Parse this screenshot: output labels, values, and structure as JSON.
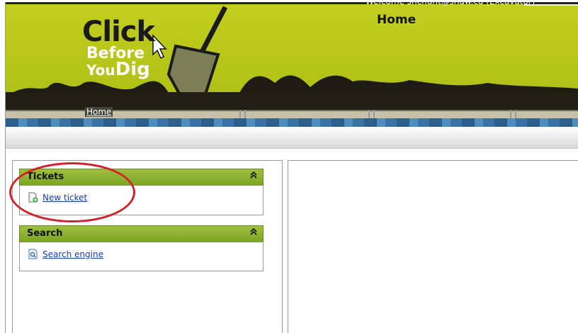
{
  "header": {
    "welcome_text": "Welcome shchunt@shaw.ca (Excavator)",
    "page_title": "Home",
    "logo_line1": "Click",
    "logo_line2": "Before",
    "logo_line3a": "You",
    "logo_line3b": "Dig"
  },
  "nav": {
    "home_label": "Home"
  },
  "panels": {
    "tickets": {
      "title": "Tickets",
      "collapse_glyph": "≈",
      "link_label": "New ticket"
    },
    "search": {
      "title": "Search",
      "collapse_glyph": "≈",
      "link_label": "Search engine"
    }
  },
  "colors": {
    "banner_green": "#b5c51a",
    "panel_header_green": "#8bb133",
    "link_blue": "#1a3aa8",
    "highlight_red": "#d3212a"
  },
  "icons": {
    "new_ticket": "document-add-icon",
    "search_engine": "search-document-icon",
    "collapse": "double-chevron-up-icon"
  }
}
